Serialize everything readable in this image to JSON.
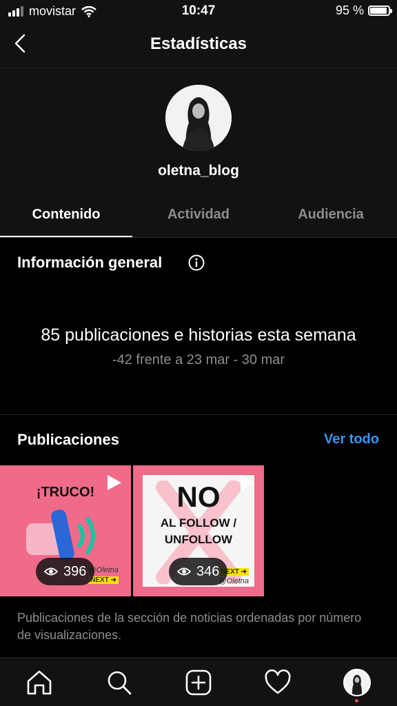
{
  "status_bar": {
    "carrier": "movistar",
    "time": "10:47",
    "battery": "95 %",
    "battery_level": 0.95
  },
  "nav": {
    "title": "Estadísticas"
  },
  "profile": {
    "username": "oletna_blog"
  },
  "tabs": [
    {
      "label": "Contenido",
      "active": true
    },
    {
      "label": "Actividad",
      "active": false
    },
    {
      "label": "Audiencia",
      "active": false
    }
  ],
  "overview": {
    "title": "Información general",
    "stat": "85 publicaciones e historias esta semana",
    "comparison": "-42 frente a 23 mar - 30 mar"
  },
  "posts_section": {
    "title": "Publicaciones",
    "see_all": "Ver todo",
    "posts": [
      {
        "headline": "¡TRUCO!",
        "views": "396",
        "brand": "@Oletna",
        "tag": "NEXT ➜"
      },
      {
        "headline": "NO",
        "subline": "AL FOLLOW / UNFOLLOW",
        "views": "346",
        "brand": "@Oletna",
        "tag": "NEXT ➜"
      }
    ],
    "description": "Publicaciones de la sección de noticias ordenadas por número de visualizaciones."
  },
  "tab_bar": {
    "icons": [
      "home-icon",
      "search-icon",
      "add-icon",
      "heart-icon",
      "profile-avatar"
    ]
  },
  "colors": {
    "accent": "#3897f0",
    "background": "#000000",
    "post_pink": "#f06b8a"
  }
}
